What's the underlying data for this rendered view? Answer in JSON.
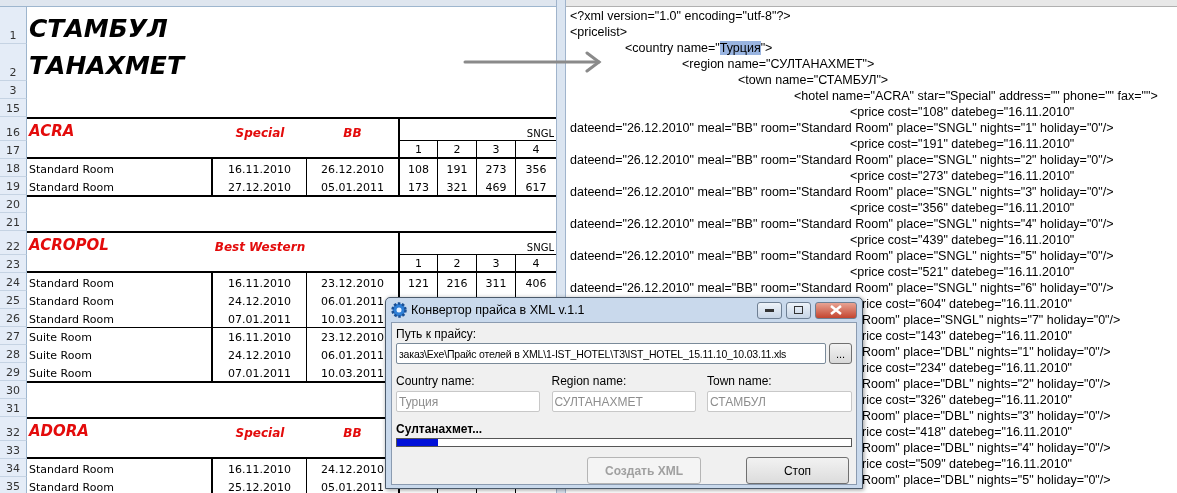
{
  "sheet": {
    "rows": [
      {
        "number": "1",
        "kind": "title",
        "text": "СТАМБУЛ"
      },
      {
        "number": "2",
        "kind": "title",
        "text": "ТАНАХМЕТ"
      },
      {
        "number": "3",
        "kind": "blank"
      },
      {
        "number": "15",
        "kind": "blank"
      },
      {
        "number": "16",
        "kind": "hotel",
        "name": "ACRA",
        "category": "Special",
        "meal": "BB",
        "place": "SNGL"
      },
      {
        "number": "17",
        "kind": "nights",
        "nights": [
          "1",
          "2",
          "3",
          "4"
        ]
      },
      {
        "number": "18",
        "kind": "price",
        "room": "Standard Room",
        "date_from": "16.11.2010",
        "date_to": "26.12.2010",
        "prices": [
          "108",
          "191",
          "273",
          "356"
        ],
        "group_start": false
      },
      {
        "number": "19",
        "kind": "price",
        "room": "Standard Room",
        "date_from": "27.12.2010",
        "date_to": "05.01.2011",
        "prices": [
          "173",
          "321",
          "469",
          "617"
        ],
        "group_start": false
      },
      {
        "number": "20",
        "kind": "blank"
      },
      {
        "number": "21",
        "kind": "blank"
      },
      {
        "number": "22",
        "kind": "hotel",
        "name": "ACROPOL",
        "category": "Best Western",
        "place": "SNGL"
      },
      {
        "number": "23",
        "kind": "nights",
        "nights": [
          "1",
          "2",
          "3",
          "4"
        ]
      },
      {
        "number": "24",
        "kind": "price",
        "room": "Standard Room",
        "date_from": "16.11.2010",
        "date_to": "23.12.2010",
        "prices": [
          "121",
          "216",
          "311",
          "406"
        ],
        "group_start": false
      },
      {
        "number": "25",
        "kind": "price",
        "room": "Standard Room",
        "date_from": "24.12.2010",
        "date_to": "06.01.2011",
        "group_start": false
      },
      {
        "number": "26",
        "kind": "price",
        "room": "Standard Room",
        "date_from": "07.01.2011",
        "date_to": "10.03.2011",
        "group_start": false
      },
      {
        "number": "27",
        "kind": "price",
        "room": "Suite Room",
        "date_from": "16.11.2010",
        "date_to": "23.12.2010",
        "group_start": true
      },
      {
        "number": "28",
        "kind": "price",
        "room": "Suite Room",
        "date_from": "24.12.2010",
        "date_to": "06.01.2011",
        "group_start": false
      },
      {
        "number": "29",
        "kind": "price",
        "room": "Suite Room",
        "date_from": "07.01.2011",
        "date_to": "10.03.2011",
        "group_start": false
      },
      {
        "number": "30",
        "kind": "blank"
      },
      {
        "number": "31",
        "kind": "blank"
      },
      {
        "number": "32",
        "kind": "hotel",
        "name": "ADORA",
        "category": "Special",
        "meal": "BB"
      },
      {
        "number": "33",
        "kind": "nights"
      },
      {
        "number": "34",
        "kind": "price",
        "room": "Standard Room",
        "date_from": "16.11.2010",
        "date_to": "24.12.2010",
        "group_start": false
      },
      {
        "number": "35",
        "kind": "price",
        "room": "Standard Room",
        "date_from": "25.12.2010",
        "date_to": "05.01.2011",
        "group_start": false
      }
    ]
  },
  "xml": {
    "lines": [
      {
        "kind": "root",
        "text": "<?xml version=\"1.0\" encoding=\"utf-8\"?>"
      },
      {
        "kind": "root",
        "text": "<pricelist>"
      },
      {
        "kind": "country",
        "parts": [
          {
            "text": "<country name=\"",
            "selected": false
          },
          {
            "text": "Турция",
            "selected": true
          },
          {
            "text": "\">",
            "selected": false
          }
        ]
      },
      {
        "kind": "region",
        "text": "<region name=\"СУЛТАНАХМЕТ\">"
      },
      {
        "kind": "town",
        "text": "<town name=\"СТАМБУЛ\">"
      },
      {
        "kind": "hotel",
        "text": "<hotel name=\"ACRA\" star=\"Special\" address=\"\" phone=\"\" fax=\"\">"
      },
      {
        "kind": "price",
        "text": "<price cost=\"108\" datebeg=\"16.11.2010\""
      },
      {
        "kind": "wrap",
        "text": "dateend=\"26.12.2010\" meal=\"BB\" room=\"Standard Room\" place=\"SNGL\" nights=\"1\" holiday=\"0\"/>"
      },
      {
        "kind": "price",
        "text": "<price cost=\"191\" datebeg=\"16.11.2010\""
      },
      {
        "kind": "wrap",
        "text": "dateend=\"26.12.2010\" meal=\"BB\" room=\"Standard Room\" place=\"SNGL\" nights=\"2\" holiday=\"0\"/>"
      },
      {
        "kind": "price",
        "text": "<price cost=\"273\" datebeg=\"16.11.2010\""
      },
      {
        "kind": "wrap",
        "text": "dateend=\"26.12.2010\" meal=\"BB\" room=\"Standard Room\" place=\"SNGL\" nights=\"3\" holiday=\"0\"/>"
      },
      {
        "kind": "price",
        "text": "<price cost=\"356\" datebeg=\"16.11.2010\""
      },
      {
        "kind": "wrap",
        "text": "dateend=\"26.12.2010\" meal=\"BB\" room=\"Standard Room\" place=\"SNGL\" nights=\"4\" holiday=\"0\"/>"
      },
      {
        "kind": "price",
        "text": "<price cost=\"439\" datebeg=\"16.11.2010\""
      },
      {
        "kind": "wrap",
        "text": "dateend=\"26.12.2010\" meal=\"BB\" room=\"Standard Room\" place=\"SNGL\" nights=\"5\" holiday=\"0\"/>"
      },
      {
        "kind": "price",
        "text": "<price cost=\"521\" datebeg=\"16.11.2010\""
      },
      {
        "kind": "wrap",
        "text": "dateend=\"26.12.2010\" meal=\"BB\" room=\"Standard Room\" place=\"SNGL\" nights=\"6\" holiday=\"0\"/>"
      },
      {
        "kind": "cut",
        "text": "rice cost=\"604\" datebeg=\"16.11.2010\""
      },
      {
        "kind": "cut",
        "text": "Room\" place=\"SNGL\" nights=\"7\" holiday=\"0\"/>"
      },
      {
        "kind": "cut",
        "text": "rice cost=\"143\" datebeg=\"16.11.2010\""
      },
      {
        "kind": "cut",
        "text": "Room\" place=\"DBL\" nights=\"1\" holiday=\"0\"/>"
      },
      {
        "kind": "cut",
        "text": "rice cost=\"234\" datebeg=\"16.11.2010\""
      },
      {
        "kind": "cut",
        "text": "Room\" place=\"DBL\" nights=\"2\" holiday=\"0\"/>"
      },
      {
        "kind": "cut",
        "text": "rice cost=\"326\" datebeg=\"16.11.2010\""
      },
      {
        "kind": "cut",
        "text": "Room\" place=\"DBL\" nights=\"3\" holiday=\"0\"/>"
      },
      {
        "kind": "cut",
        "text": "rice cost=\"418\" datebeg=\"16.11.2010\""
      },
      {
        "kind": "cut",
        "text": "Room\" place=\"DBL\" nights=\"4\" holiday=\"0\"/>"
      },
      {
        "kind": "cut",
        "text": "rice cost=\"509\" datebeg=\"16.11.2010\""
      },
      {
        "kind": "cut",
        "text": "Room\" place=\"DBL\" nights=\"5\" holiday=\"0\"/>"
      }
    ]
  },
  "dialog": {
    "title": "Конвертор прайса в XML v.1.1",
    "path_label": "Путь к прайсу:",
    "path_value": "заказ\\Exe\\Прайс отелей в XML\\1-IST_HOTEL\\T3\\IST_HOTEL_15.11.10_10.03.11.xls",
    "browse": "...",
    "fields": [
      {
        "label": "Country name:",
        "value": "Турция",
        "disabled": true
      },
      {
        "label": "Region name:",
        "value": "СУЛТАНАХМЕТ",
        "disabled": true
      },
      {
        "label": "Town name:",
        "value": "СТАМБУЛ",
        "disabled": true
      }
    ],
    "status": "Султанахмет...",
    "progress": {
      "level": 0.09
    },
    "buttons": [
      {
        "label": "Создать XML",
        "disabled": true
      },
      {
        "label": "Стоп",
        "disabled": false
      }
    ]
  }
}
